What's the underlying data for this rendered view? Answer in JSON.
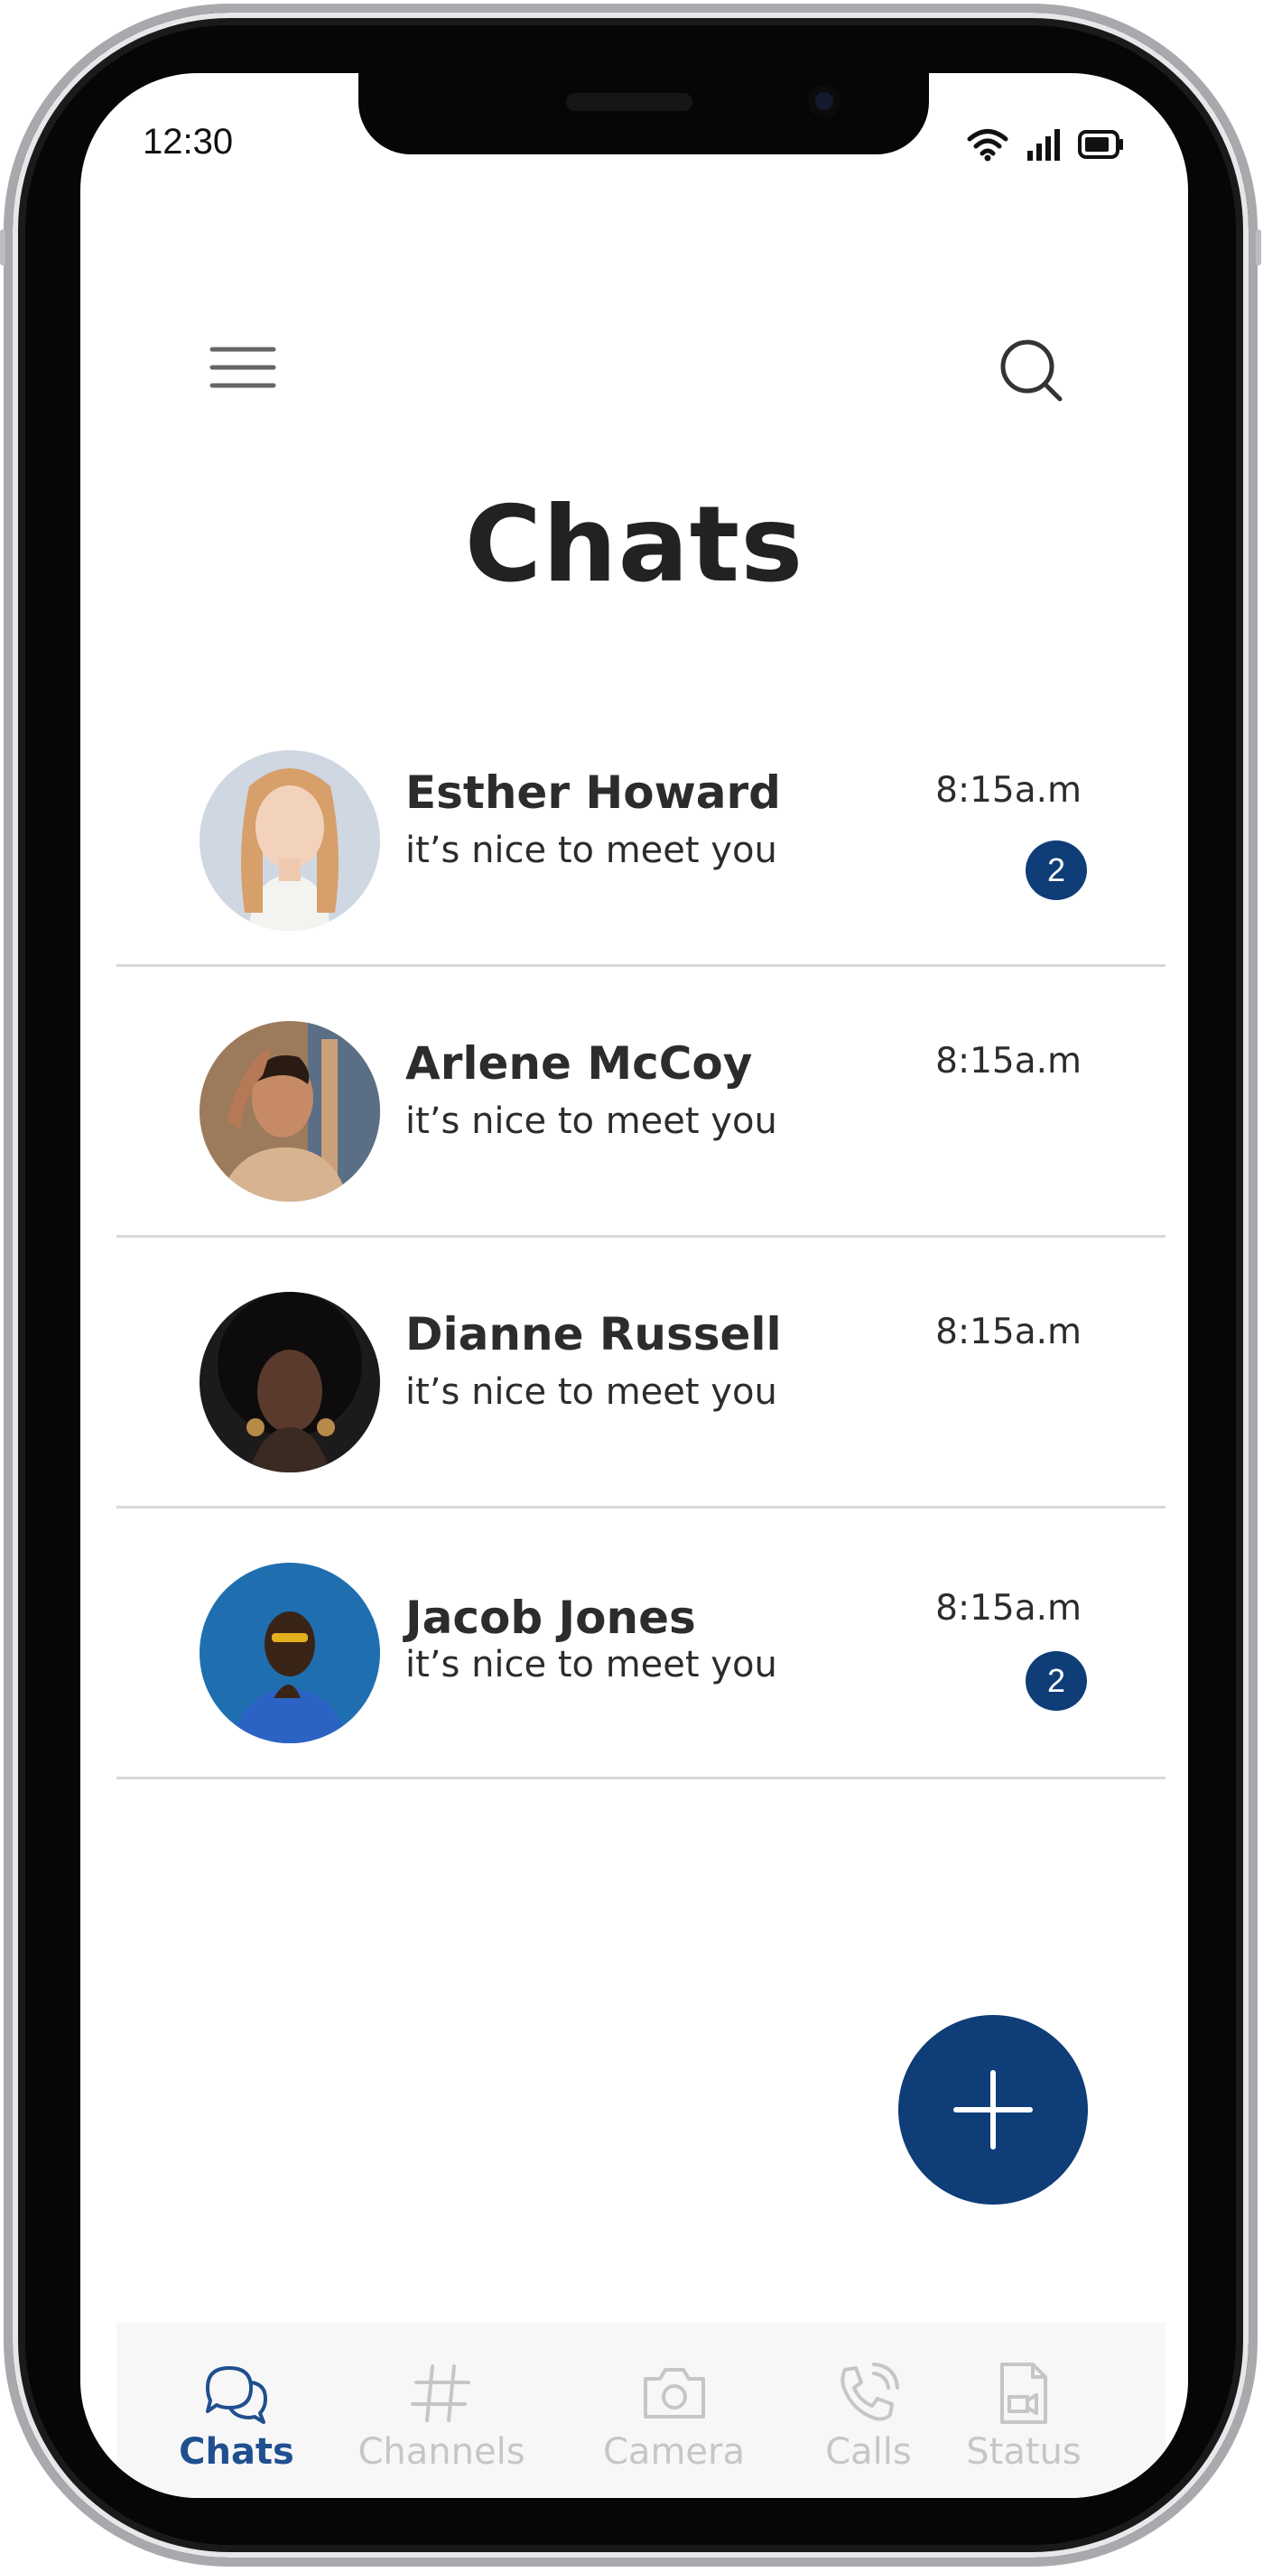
{
  "status_bar": {
    "time": "12:30",
    "icons": [
      "wifi-icon",
      "signal-icon",
      "battery-icon"
    ]
  },
  "header": {
    "menu_icon": "hamburger-menu-icon",
    "search_icon": "search-icon",
    "title": "Chats"
  },
  "chats": [
    {
      "name": "Esther Howard",
      "preview": "it’s nice to meet you",
      "time": "8:15a.m",
      "unread": "2"
    },
    {
      "name": "Arlene McCoy",
      "preview": "it’s nice to meet you",
      "time": "8:15a.m"
    },
    {
      "name": "Dianne Russell",
      "preview": "it’s nice to meet you",
      "time": "8:15a.m"
    },
    {
      "name": "Jacob Jones",
      "preview": "it’s nice to meet you",
      "time": "8:15a.m",
      "unread": "2"
    }
  ],
  "fab": {
    "icon": "plus-icon"
  },
  "bottom_nav": [
    {
      "label": "Chats",
      "icon": "chat-bubbles-icon",
      "active": true
    },
    {
      "label": "Channels",
      "icon": "hashtag-icon",
      "active": false
    },
    {
      "label": "Camera",
      "icon": "camera-icon",
      "active": false
    },
    {
      "label": "Calls",
      "icon": "phone-icon",
      "active": false
    },
    {
      "label": "Status",
      "icon": "status-icon",
      "active": false
    }
  ],
  "colors": {
    "accent": "#0e3d78",
    "nav_active": "#1f4f8f",
    "nav_inactive": "#c6c6c8",
    "text": "#2c2c2c",
    "divider": "#d8d8d8"
  }
}
